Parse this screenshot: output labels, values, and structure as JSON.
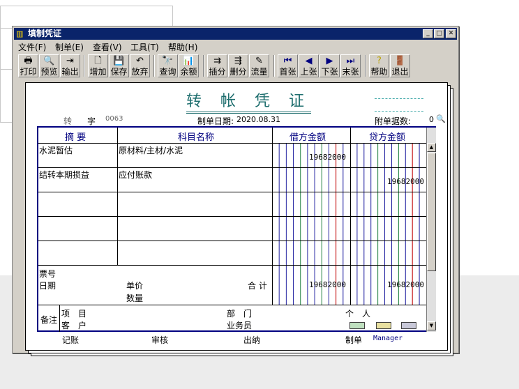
{
  "window": {
    "title": "填制凭证"
  },
  "menu": [
    "文件(F)",
    "制单(E)",
    "查看(V)",
    "工具(T)",
    "帮助(H)"
  ],
  "toolbar": {
    "print": "打印",
    "preview": "预览",
    "export": "输出",
    "add": "增加",
    "save": "保存",
    "discard": "放弃",
    "query": "查询",
    "balance": "余额",
    "insert": "插分",
    "delete": "删分",
    "flow": "流量",
    "first": "首张",
    "prev": "上张",
    "next": "下张",
    "last": "末张",
    "help": "帮助",
    "exit": "退出"
  },
  "voucher": {
    "title": "转 帐 凭 证",
    "type": "转",
    "type_suffix": "字",
    "number": "0063",
    "date_label": "制单日期:",
    "date": "2020.08.31",
    "attach_label": "附单据数:",
    "attach_count": "0",
    "headers": {
      "summary": "摘 要",
      "account": "科目名称",
      "debit": "借方金额",
      "credit": "贷方金额"
    },
    "rows": [
      {
        "summary": "水泥暂估",
        "account": "原材料/主材/水泥",
        "debit": "19682000",
        "credit": ""
      },
      {
        "summary": "结转本期损益",
        "account": "应付账款",
        "debit": "",
        "credit": "19682000"
      }
    ],
    "ticket_label": "票号",
    "date2_label": "日期",
    "unit_price_label": "单价",
    "quantity_label": "数量",
    "total_label": "合 计",
    "total_debit": "19682000",
    "total_credit": "19682000",
    "remark_label": "备注",
    "project_label": "项　目",
    "customer_label": "客　户",
    "dept_label": "部　门",
    "person_label": "个　人",
    "salesman_label": "业务员"
  },
  "footer": {
    "bookkeep": "记账",
    "audit": "审核",
    "cashier": "出纳",
    "maker": "制单",
    "maker_name": "Manager"
  }
}
